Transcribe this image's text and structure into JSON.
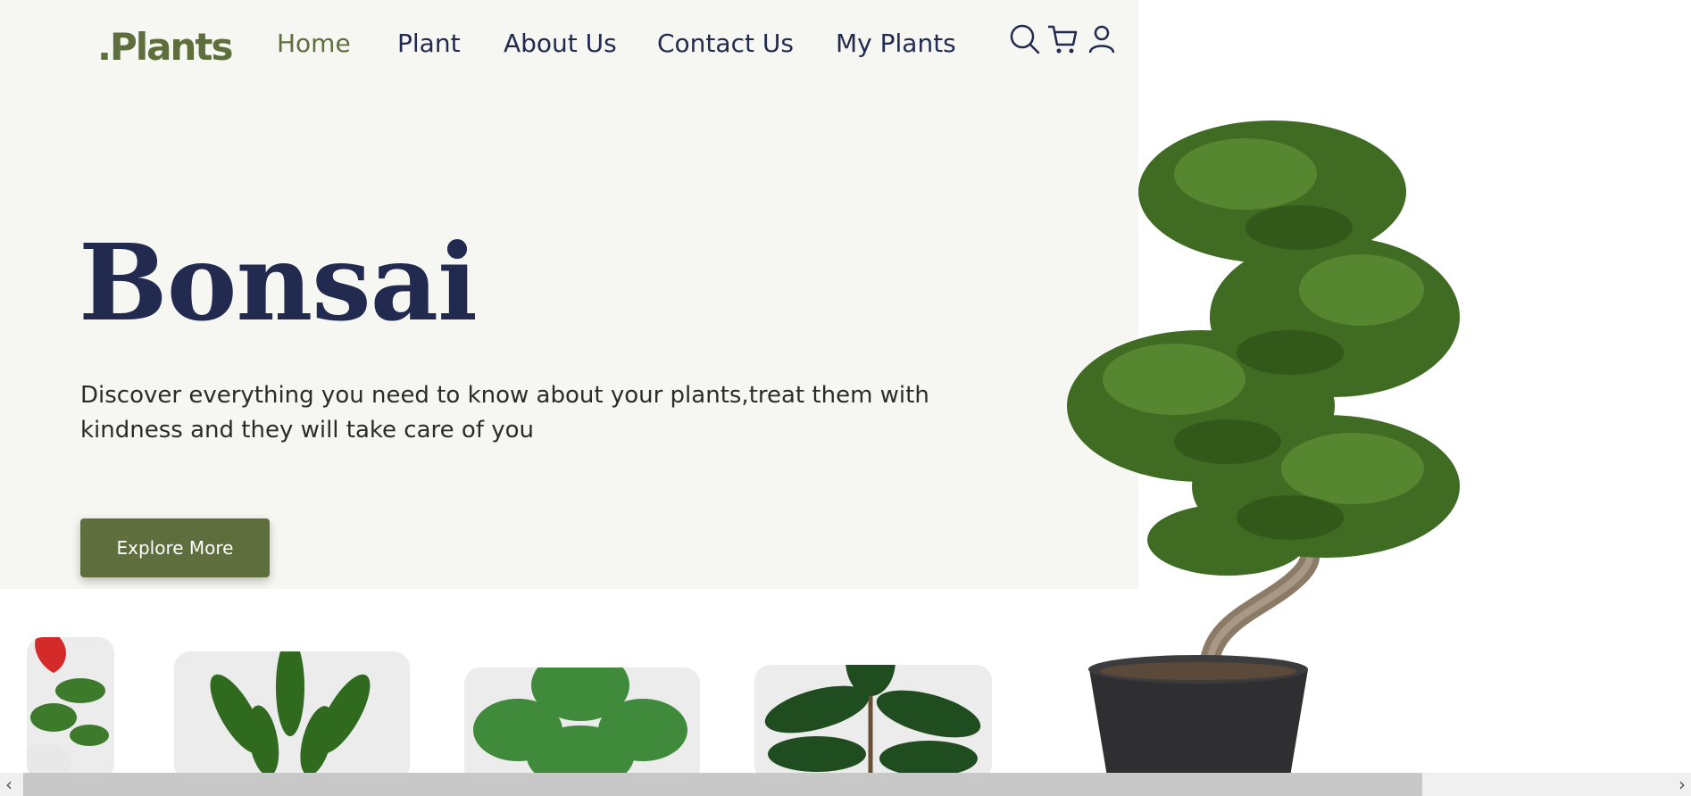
{
  "header": {
    "logo": ".Plants",
    "nav": [
      "Home",
      "Plant",
      "About Us",
      "Contact Us",
      "My Plants"
    ],
    "active_nav": "Home",
    "icons": [
      "search-icon",
      "cart-icon",
      "user-icon"
    ]
  },
  "hero": {
    "title": "Bonsai",
    "description": "Discover everything you need to know about your plants,treat them with kindness and they will take care of you",
    "cta": "Explore More"
  },
  "carousel": {
    "items": [
      "anthurium-plant",
      "zz-plant",
      "monstera-plant",
      "rubber-plant"
    ]
  },
  "colors": {
    "brand_green": "#5e6e3c",
    "navy": "#222b4f",
    "hero_bg": "#f6f6f2"
  }
}
